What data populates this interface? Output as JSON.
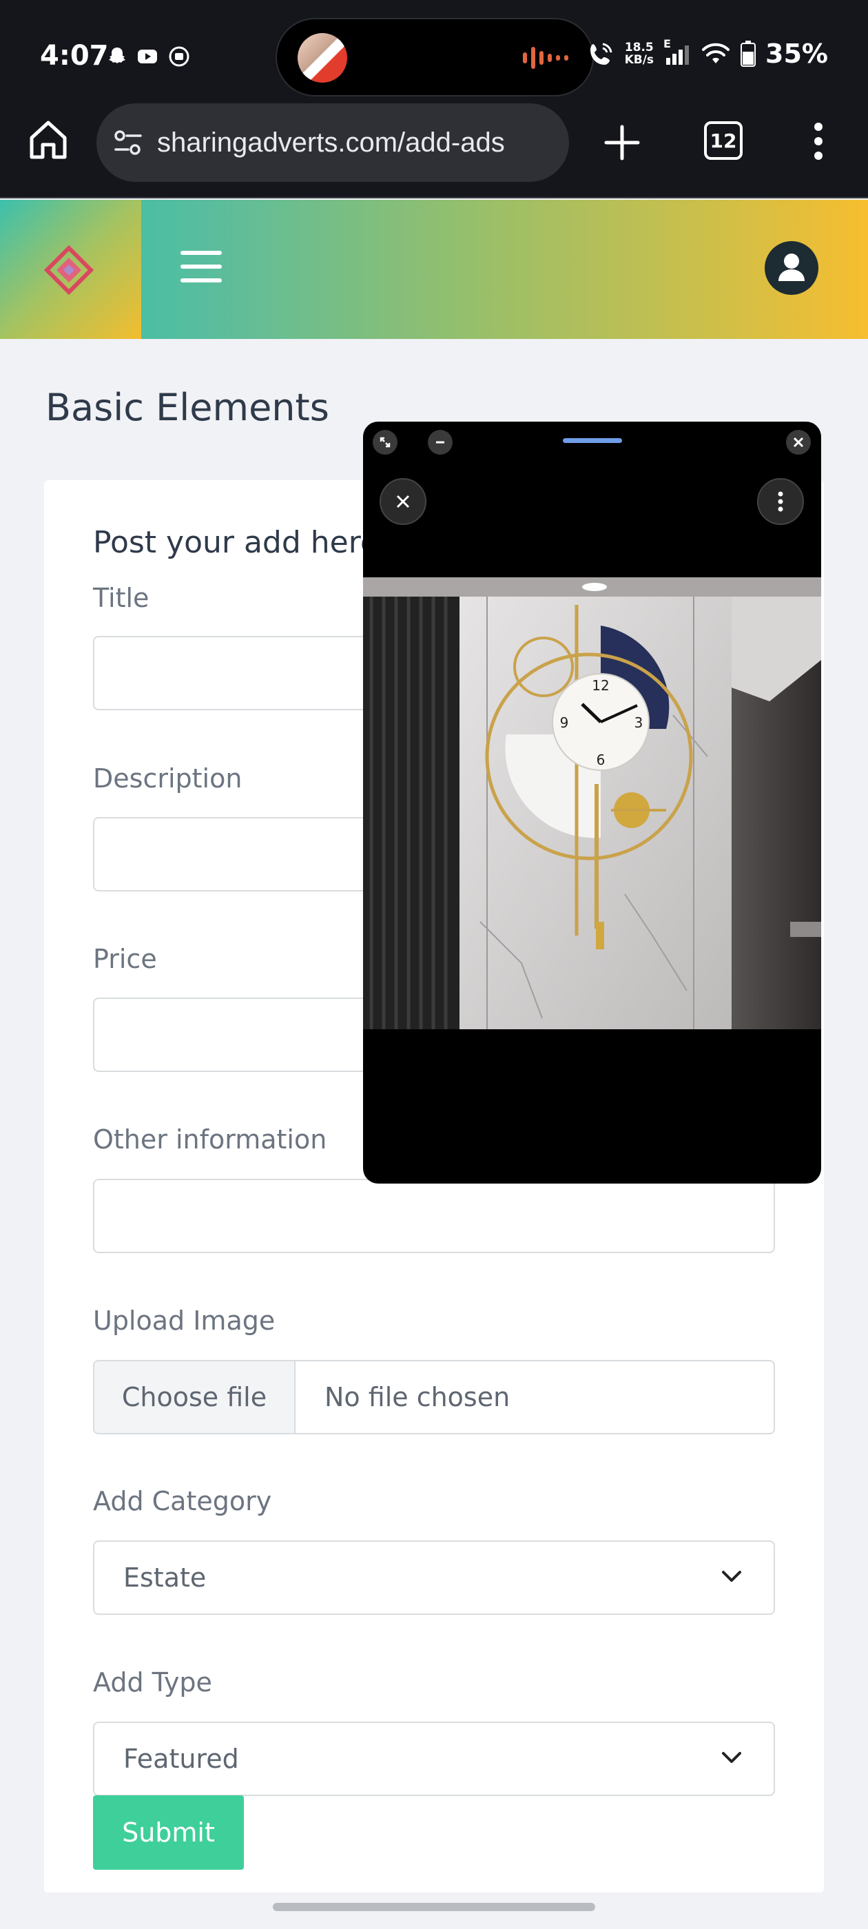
{
  "status_bar": {
    "time": "4:07",
    "net_speed_value": "18.5",
    "net_speed_unit": "KB/s",
    "network_type": "E",
    "battery": "35%"
  },
  "browser": {
    "url": "sharingadverts.com/add-ads",
    "tab_count": "12"
  },
  "page": {
    "title": "Basic Elements"
  },
  "form": {
    "heading": "Post your add here",
    "title_label": "Title",
    "description_label": "Description",
    "price_label": "Price",
    "other_label": "Other information",
    "upload_label": "Upload Image",
    "choose_file": "Choose file",
    "no_file": "No file chosen",
    "category_label": "Add Category",
    "category_value": "Estate",
    "type_label": "Add Type",
    "type_value": "Featured",
    "submit": "Submit"
  },
  "colors": {
    "accent": "#3fcf9a",
    "header_start": "#2ec0b0",
    "header_end": "#f7be2f",
    "pip_handle": "#6f9ee8"
  }
}
